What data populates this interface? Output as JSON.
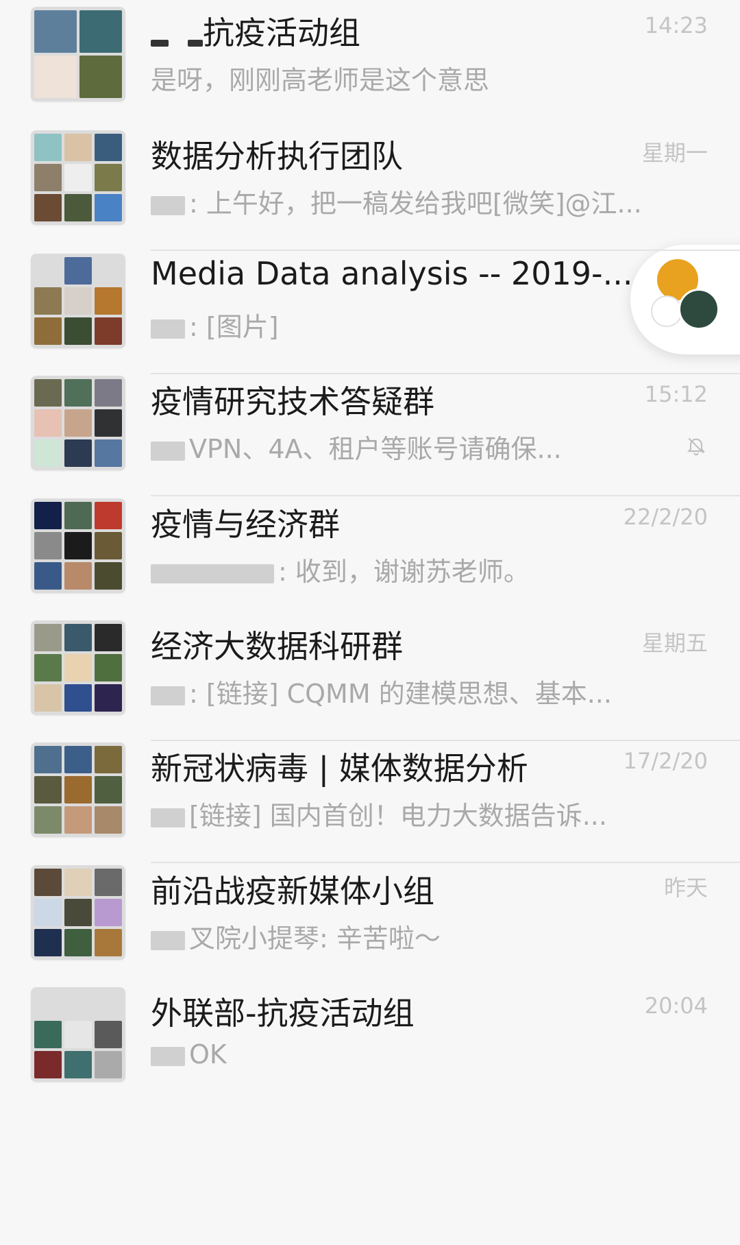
{
  "chats": [
    {
      "title": "抗疫活动组",
      "title_prefix_blurred": true,
      "time": "14:23",
      "preview": "是呀，刚刚高老师是这个意思",
      "muted": false,
      "avatar_grid": 4,
      "avatar_colors": [
        "#5d7f9c",
        "#3d6b73",
        "#efe2d8",
        "#5e6b3c"
      ]
    },
    {
      "title": "数据分析执行团队",
      "time": "星期一",
      "preview": ": 上午好，把一稿发给我吧[微笑]@江...",
      "muted": false,
      "avatar_grid": 9,
      "avatar_colors": [
        "#8ec2c3",
        "#d9c2a5",
        "#3a5d7e",
        "#8d7f6a",
        "#eeeeee",
        "#7a7a4a",
        "#6b4b34",
        "#4b5a3b",
        "#4a82c6"
      ]
    },
    {
      "title": "Media Data analysis -- 2019-...",
      "time": "",
      "preview": ": [图片]",
      "muted": false,
      "avatar_grid": 9,
      "avatar_colors": [
        "#dcdcdc",
        "#4c6b9a",
        "#dcdcdc",
        "#8d7a52",
        "#d7d0c9",
        "#b6772f",
        "#8f6d3a",
        "#3b4d33",
        "#7d3b2a"
      ]
    },
    {
      "title": "疫情研究技术答疑群",
      "time": "15:12",
      "preview": "VPN、4A、租户等账号请确保...",
      "muted": true,
      "avatar_grid": 9,
      "avatar_colors": [
        "#6a6a52",
        "#50705a",
        "#7b7a86",
        "#e6c1b4",
        "#c7a58c",
        "#2f3132",
        "#cfe6d6",
        "#2c3a52",
        "#5577a0"
      ]
    },
    {
      "title": "疫情与经济群",
      "time": "22/2/20",
      "preview": ": 收到，谢谢苏老师。",
      "muted": false,
      "avatar_grid": 9,
      "avatar_colors": [
        "#12204a",
        "#4f6a54",
        "#bf3a2e",
        "#8a8a8a",
        "#1b1b1b",
        "#6a5a35",
        "#395a88",
        "#b88a6a",
        "#4b4b2f"
      ]
    },
    {
      "title": "经济大数据科研群",
      "time": "星期五",
      "preview": ": [链接] CQMM 的建模思想、基本...",
      "muted": false,
      "avatar_grid": 9,
      "avatar_colors": [
        "#9a9a8a",
        "#3a5a6c",
        "#2a2a2a",
        "#5a7a4a",
        "#e8d2b0",
        "#4f6f3f",
        "#d8c5a8",
        "#2f4f8f",
        "#2d2450"
      ]
    },
    {
      "title": "新冠状病毒 | 媒体数据分析",
      "time": "17/2/20",
      "preview": "[链接] 国内首创！电力大数据告诉...",
      "muted": false,
      "avatar_grid": 9,
      "avatar_colors": [
        "#4f6f8f",
        "#3c5f8a",
        "#7a6a3c",
        "#5a5a3f",
        "#9a6a2f",
        "#4f5f3f",
        "#7c8a6a",
        "#c49a7a",
        "#a88a6a"
      ]
    },
    {
      "title": "前沿战疫新媒体小组",
      "time": "昨天",
      "preview": "叉院小提琴: 辛苦啦～",
      "muted": false,
      "avatar_grid": 9,
      "avatar_colors": [
        "#5b4a3a",
        "#e0d0b8",
        "#6a6a6a",
        "#ccd8e6",
        "#4a4a3a",
        "#b89ad0",
        "#1f2f4f",
        "#3f5f3f",
        "#a8783a"
      ]
    },
    {
      "title": "外联部-抗疫活动组",
      "time": "20:04",
      "preview": "OK",
      "muted": false,
      "avatar_grid": 9,
      "avatar_colors": [
        "#dcdcdc",
        "#dcdcdc",
        "#dcdcdc",
        "#3a6a5a",
        "#e6e6e6",
        "#5a5a5a",
        "#7a2a2a",
        "#3f6f6f",
        "#aaaaaa"
      ]
    }
  ],
  "float_widget": {
    "colors": [
      "#e8a21f",
      "#2e4a3e",
      "#ffffff"
    ]
  }
}
